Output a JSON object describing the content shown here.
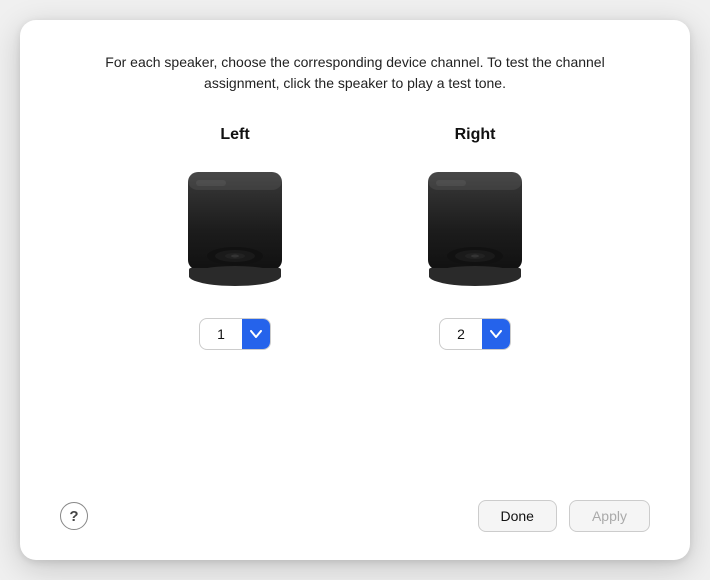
{
  "dialog": {
    "instruction": "For each speaker, choose the corresponding device channel. To test the channel assignment, click the speaker to play a test tone."
  },
  "speakers": [
    {
      "id": "left",
      "label": "Left",
      "channel_value": "1"
    },
    {
      "id": "right",
      "label": "Right",
      "channel_value": "2"
    }
  ],
  "buttons": {
    "help": "?",
    "done": "Done",
    "apply": "Apply"
  },
  "colors": {
    "dropdown_blue": "#2563eb",
    "speaker_dark": "#1e1e1e"
  }
}
